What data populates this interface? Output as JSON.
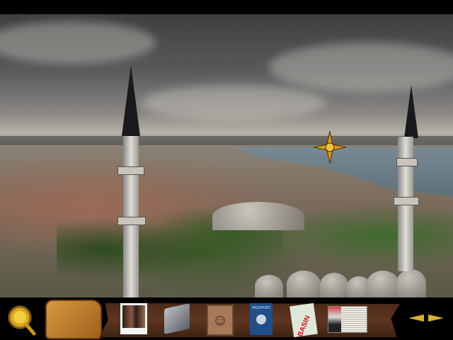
{
  "scene": {
    "name": "istanbul-panorama-mosque-view",
    "cursor": "compass-navigation-icon"
  },
  "inventory": {
    "tools": [
      {
        "name": "magnifier",
        "icon": "magnifying-glass-icon"
      },
      {
        "name": "bag",
        "icon": "leather-bag-icon"
      }
    ],
    "items": [
      {
        "name": "photograph",
        "icon": "photo-icon"
      },
      {
        "name": "polaroid-camera",
        "icon": "camera-icon"
      },
      {
        "name": "portrait-sketch",
        "icon": "portrait-icon"
      },
      {
        "name": "passport",
        "icon": "passport-icon",
        "label": "PASSPORT"
      },
      {
        "name": "press-pass",
        "icon": "ticket-icon",
        "label": "BASIN"
      },
      {
        "name": "newspaper",
        "icon": "newspaper-icon"
      }
    ],
    "scroll": {
      "left": "arrow-left-icon",
      "right": "arrow-right-icon"
    }
  },
  "colors": {
    "accent": "#d8b030",
    "shelf": "#5e3520"
  }
}
